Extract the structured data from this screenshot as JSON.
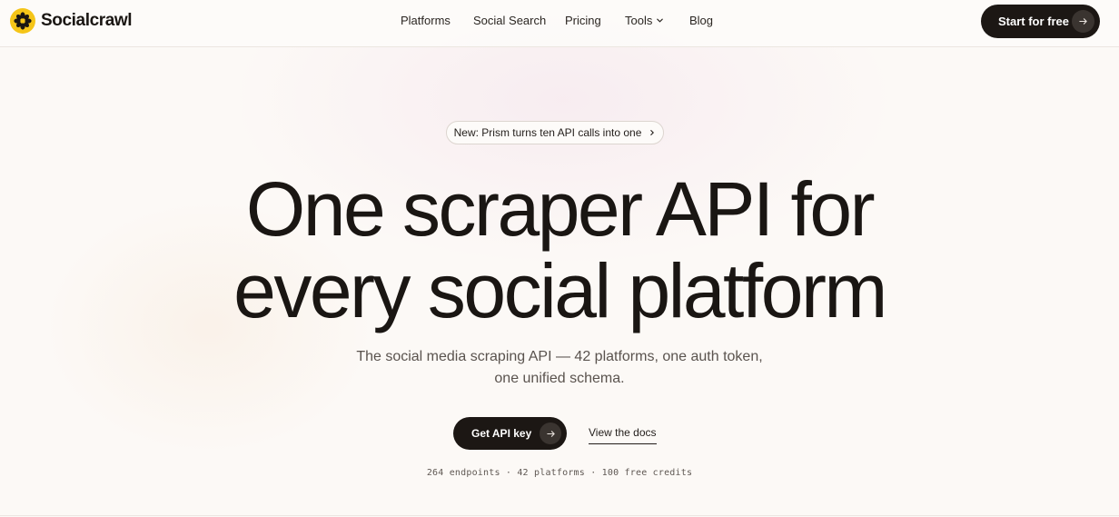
{
  "brand": {
    "name": "Socialcrawl",
    "accent": "#f5c518",
    "dark": "#1c1714"
  },
  "nav": {
    "items": [
      {
        "label": "Platforms"
      },
      {
        "label": "Social Search"
      },
      {
        "label": "Pricing"
      },
      {
        "label": "Tools"
      },
      {
        "label": "Blog"
      }
    ],
    "cta_label": "Start for free"
  },
  "hero": {
    "announcement": "New: Prism turns ten API calls into one",
    "headline_line1": "One scraper API for",
    "headline_line2": "every social platform",
    "subhead_line1": "The social media scraping API — 42 platforms, one auth token,",
    "subhead_line2": "one unified schema.",
    "primary_cta": "Get API key",
    "secondary_cta": "View the docs",
    "stats": "264 endpoints · 42 platforms · 100 free credits"
  },
  "icons": {
    "logo": "flower-logo-icon",
    "cta_arrow": "arrow-right-icon",
    "tools_caret": "chevron-down-icon",
    "announce_caret": "chevron-right-icon"
  }
}
